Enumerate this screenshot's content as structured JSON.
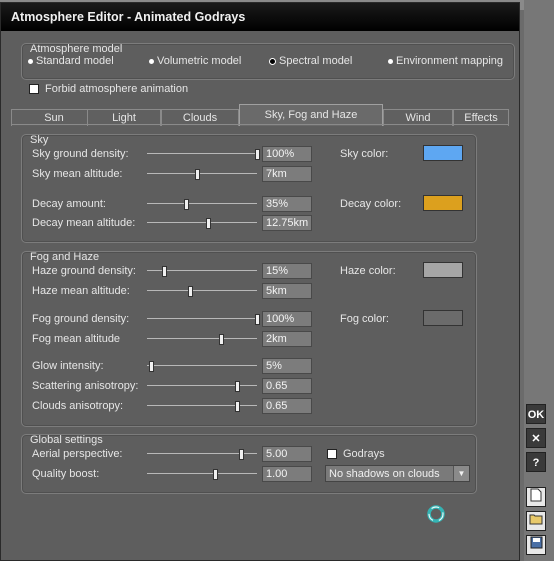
{
  "window": {
    "title": "Atmosphere Editor - Animated Godrays"
  },
  "atmosphere_model": {
    "title": "Atmosphere model",
    "options": [
      "Standard model",
      "Volumetric model",
      "Spectral model",
      "Environment mapping"
    ],
    "selected": "Spectral model"
  },
  "forbid_animation": {
    "label": "Forbid atmosphere animation",
    "checked": false
  },
  "tabs": [
    "Sun",
    "Light",
    "Clouds",
    "Sky, Fog and Haze",
    "Wind",
    "Effects"
  ],
  "active_tab": "Sky, Fog and Haze",
  "sky": {
    "title": "Sky",
    "ground_density": {
      "label": "Sky ground density:",
      "value": "100%",
      "level": 1.0
    },
    "mean_altitude": {
      "label": "Sky mean altitude:",
      "value": "7km",
      "level": 0.45
    },
    "decay_amount": {
      "label": "Decay amount:",
      "value": "35%",
      "level": 0.35
    },
    "decay_mean_altitude": {
      "label": "Decay mean altitude:",
      "value": "12.75km",
      "level": 0.55
    },
    "sky_color": {
      "label": "Sky color:",
      "color": "#5ea7f2"
    },
    "decay_color": {
      "label": "Decay color:",
      "color": "#dca01e"
    }
  },
  "fog": {
    "title": "Fog and Haze",
    "haze_ground_density": {
      "label": "Haze ground density:",
      "value": "15%",
      "level": 0.15
    },
    "haze_mean_altitude": {
      "label": "Haze mean altitude:",
      "value": "5km",
      "level": 0.39
    },
    "fog_ground_density": {
      "label": "Fog ground density:",
      "value": "100%",
      "level": 1.0
    },
    "fog_mean_altitude": {
      "label": "Fog mean altitude",
      "value": "2km",
      "level": 0.67
    },
    "glow_intensity": {
      "label": "Glow intensity:",
      "value": "5%",
      "level": 0.04
    },
    "scattering_anisotropy": {
      "label": "Scattering anisotropy:",
      "value": "0.65",
      "level": 0.82
    },
    "clouds_anisotropy": {
      "label": "Clouds anisotropy:",
      "value": "0.65",
      "level": 0.82
    },
    "haze_color": {
      "label": "Haze color:",
      "color": "#a6a6a6"
    },
    "fog_color": {
      "label": "Fog color:",
      "color": "#6b6b6b"
    }
  },
  "global": {
    "title": "Global settings",
    "aerial_perspective": {
      "label": "Aerial perspective:",
      "value": "5.00",
      "level": 0.85
    },
    "quality_boost": {
      "label": "Quality boost:",
      "value": "1.00",
      "level": 0.62
    },
    "godrays": {
      "label": "Godrays",
      "checked": false
    },
    "shadows_select": {
      "value": "No shadows on clouds"
    }
  },
  "side_buttons": {
    "ok": "OK",
    "close": "✕",
    "help": "?"
  },
  "colors": {
    "titlebar": "#000000",
    "panel": "#5e5e5e",
    "accent": "#34b4b4"
  }
}
